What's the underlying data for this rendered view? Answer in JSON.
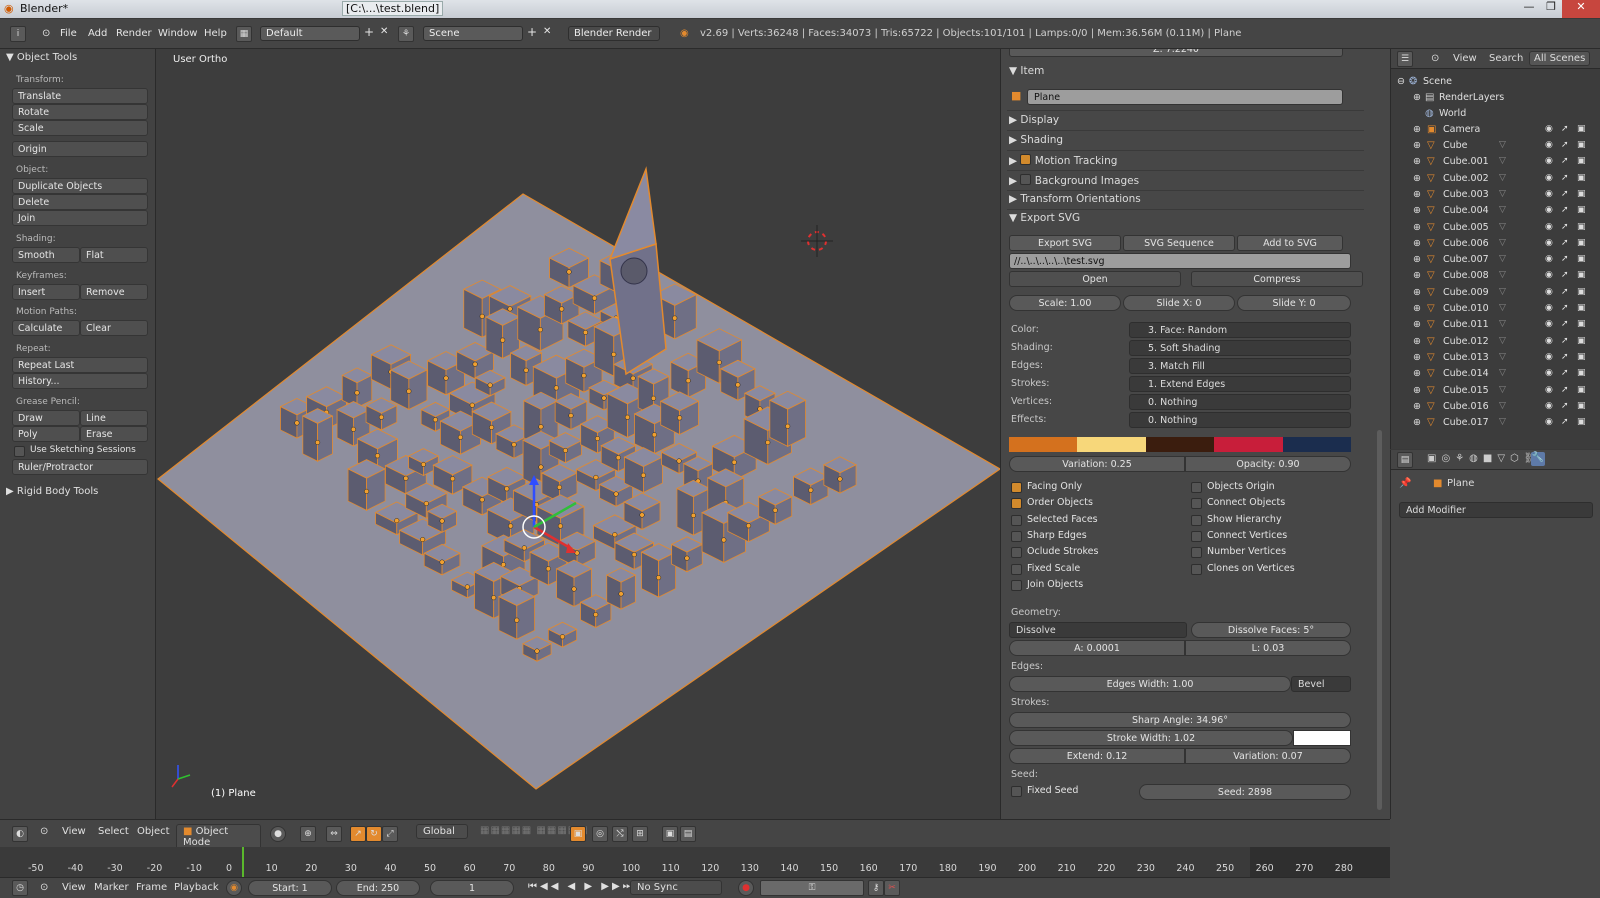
{
  "window": {
    "title": "Blender*",
    "file": "[C:\\...\\test.blend]"
  },
  "topbar": {
    "menus": [
      "File",
      "Add",
      "Render",
      "Window",
      "Help"
    ],
    "layout": "Default",
    "scene": "Scene",
    "engine": "Blender Render",
    "stats": "v2.69 | Verts:36248 | Faces:34073 | Tris:65722 | Objects:101/101 | Lamps:0/0 | Mem:36.56M (0.11M) | Plane"
  },
  "toolshelf": {
    "title": "Object Tools",
    "transform_label": "Transform:",
    "translate": "Translate",
    "rotate": "Rotate",
    "scale": "Scale",
    "origin": "Origin",
    "object_label": "Object:",
    "duplicate": "Duplicate Objects",
    "delete": "Delete",
    "join": "Join",
    "shading_label": "Shading:",
    "smooth": "Smooth",
    "flat": "Flat",
    "keyframes_label": "Keyframes:",
    "insert": "Insert",
    "remove": "Remove",
    "motion_label": "Motion Paths:",
    "calculate": "Calculate",
    "clear": "Clear",
    "repeat_label": "Repeat:",
    "repeat_last": "Repeat Last",
    "history": "History...",
    "grease_label": "Grease Pencil:",
    "draw": "Draw",
    "line": "Line",
    "poly": "Poly",
    "erase": "Erase",
    "use_sketching": "Use Sketching Sessions",
    "ruler": "Ruler/Protractor",
    "rigid": "Rigid Body Tools"
  },
  "viewport": {
    "view_name": "User Ortho",
    "object_label": "(1) Plane"
  },
  "properties": {
    "z_field": "Z: 7.2240",
    "item_title": "Item",
    "item_name": "Plane",
    "display": "Display",
    "shading": "Shading",
    "motion_tracking": "Motion Tracking",
    "background_images": "Background Images",
    "transform_orientations": "Transform Orientations",
    "export_svg": "Export SVG",
    "export_btn": "Export SVG",
    "sequence_btn": "SVG Sequence",
    "add_btn": "Add to SVG",
    "path": "//..\\..\\..\\..\\..\\test.svg",
    "open": "Open",
    "compress": "Compress",
    "scale": "Scale: 1.00",
    "slide_x": "Slide X: 0",
    "slide_y": "Slide Y: 0",
    "rows": [
      {
        "label": "Color:",
        "value": "3. Face: Random"
      },
      {
        "label": "Shading:",
        "value": "5. Soft Shading"
      },
      {
        "label": "Edges:",
        "value": "3. Match Fill"
      },
      {
        "label": "Strokes:",
        "value": "1. Extend Edges"
      },
      {
        "label": "Vertices:",
        "value": "0. Nothing"
      },
      {
        "label": "Effects:",
        "value": "0. Nothing"
      }
    ],
    "palette": [
      "#d4711e",
      "#f7d77a",
      "#3b1d0e",
      "#c81e3a",
      "#1b2d4e"
    ],
    "variation": "Variation: 0.25",
    "opacity": "Opacity: 0.90",
    "checks_left": [
      {
        "label": "Facing Only",
        "on": true
      },
      {
        "label": "Order Objects",
        "on": true
      },
      {
        "label": "Selected Faces",
        "on": false
      },
      {
        "label": "Sharp Edges",
        "on": false
      },
      {
        "label": "Oclude Strokes",
        "on": false
      },
      {
        "label": "Fixed Scale",
        "on": false
      },
      {
        "label": "Join Objects",
        "on": false
      }
    ],
    "checks_right": [
      {
        "label": "Objects Origin",
        "on": false
      },
      {
        "label": "Connect Objects",
        "on": false
      },
      {
        "label": "Show Hierarchy",
        "on": false
      },
      {
        "label": "Connect Vertices",
        "on": false
      },
      {
        "label": "Number Vertices",
        "on": false
      },
      {
        "label": "Clones on Vertices",
        "on": false
      }
    ],
    "geometry_label": "Geometry:",
    "dissolve": "Dissolve",
    "dissolve_faces": "Dissolve Faces: 5°",
    "a_val": "A: 0.0001",
    "l_val": "L: 0.03",
    "edges_label": "Edges:",
    "edges_width": "Edges Width: 1.00",
    "bevel": "Bevel",
    "strokes_label": "Strokes:",
    "sharp_angle": "Sharp Angle: 34.96°",
    "stroke_width": "Stroke Width: 1.02",
    "extend": "Extend: 0.12",
    "variation2": "Variation: 0.07",
    "seed_label": "Seed:",
    "fixed_seed": "Fixed Seed",
    "seed": "Seed: 2898"
  },
  "outliner": {
    "view": "View",
    "search": "Search",
    "scenes": "All Scenes",
    "scene": "Scene",
    "renderlayers": "RenderLayers",
    "world": "World",
    "camera": "Camera",
    "objects": [
      "Cube",
      "Cube.001",
      "Cube.002",
      "Cube.003",
      "Cube.004",
      "Cube.005",
      "Cube.006",
      "Cube.007",
      "Cube.008",
      "Cube.009",
      "Cube.010",
      "Cube.011",
      "Cube.012",
      "Cube.013",
      "Cube.014",
      "Cube.015",
      "Cube.016",
      "Cube.017"
    ]
  },
  "modifiers": {
    "object": "Plane",
    "add_modifier": "Add Modifier"
  },
  "view_header": {
    "view": "View",
    "select": "Select",
    "object": "Object",
    "mode": "Object Mode",
    "orientation": "Global"
  },
  "timeline": {
    "ticks": [
      "-50",
      "-40",
      "-30",
      "-20",
      "-10",
      "0",
      "10",
      "20",
      "30",
      "40",
      "50",
      "60",
      "70",
      "80",
      "90",
      "100",
      "110",
      "120",
      "130",
      "140",
      "150",
      "160",
      "170",
      "180",
      "190",
      "200",
      "210",
      "220",
      "230",
      "240",
      "250",
      "260",
      "270",
      "280"
    ],
    "current_frame": 0
  },
  "tl_header": {
    "view": "View",
    "marker": "Marker",
    "frame": "Frame",
    "playback": "Playback",
    "start": "Start: 1",
    "end": "End: 250",
    "current": "1",
    "sync": "No Sync"
  }
}
